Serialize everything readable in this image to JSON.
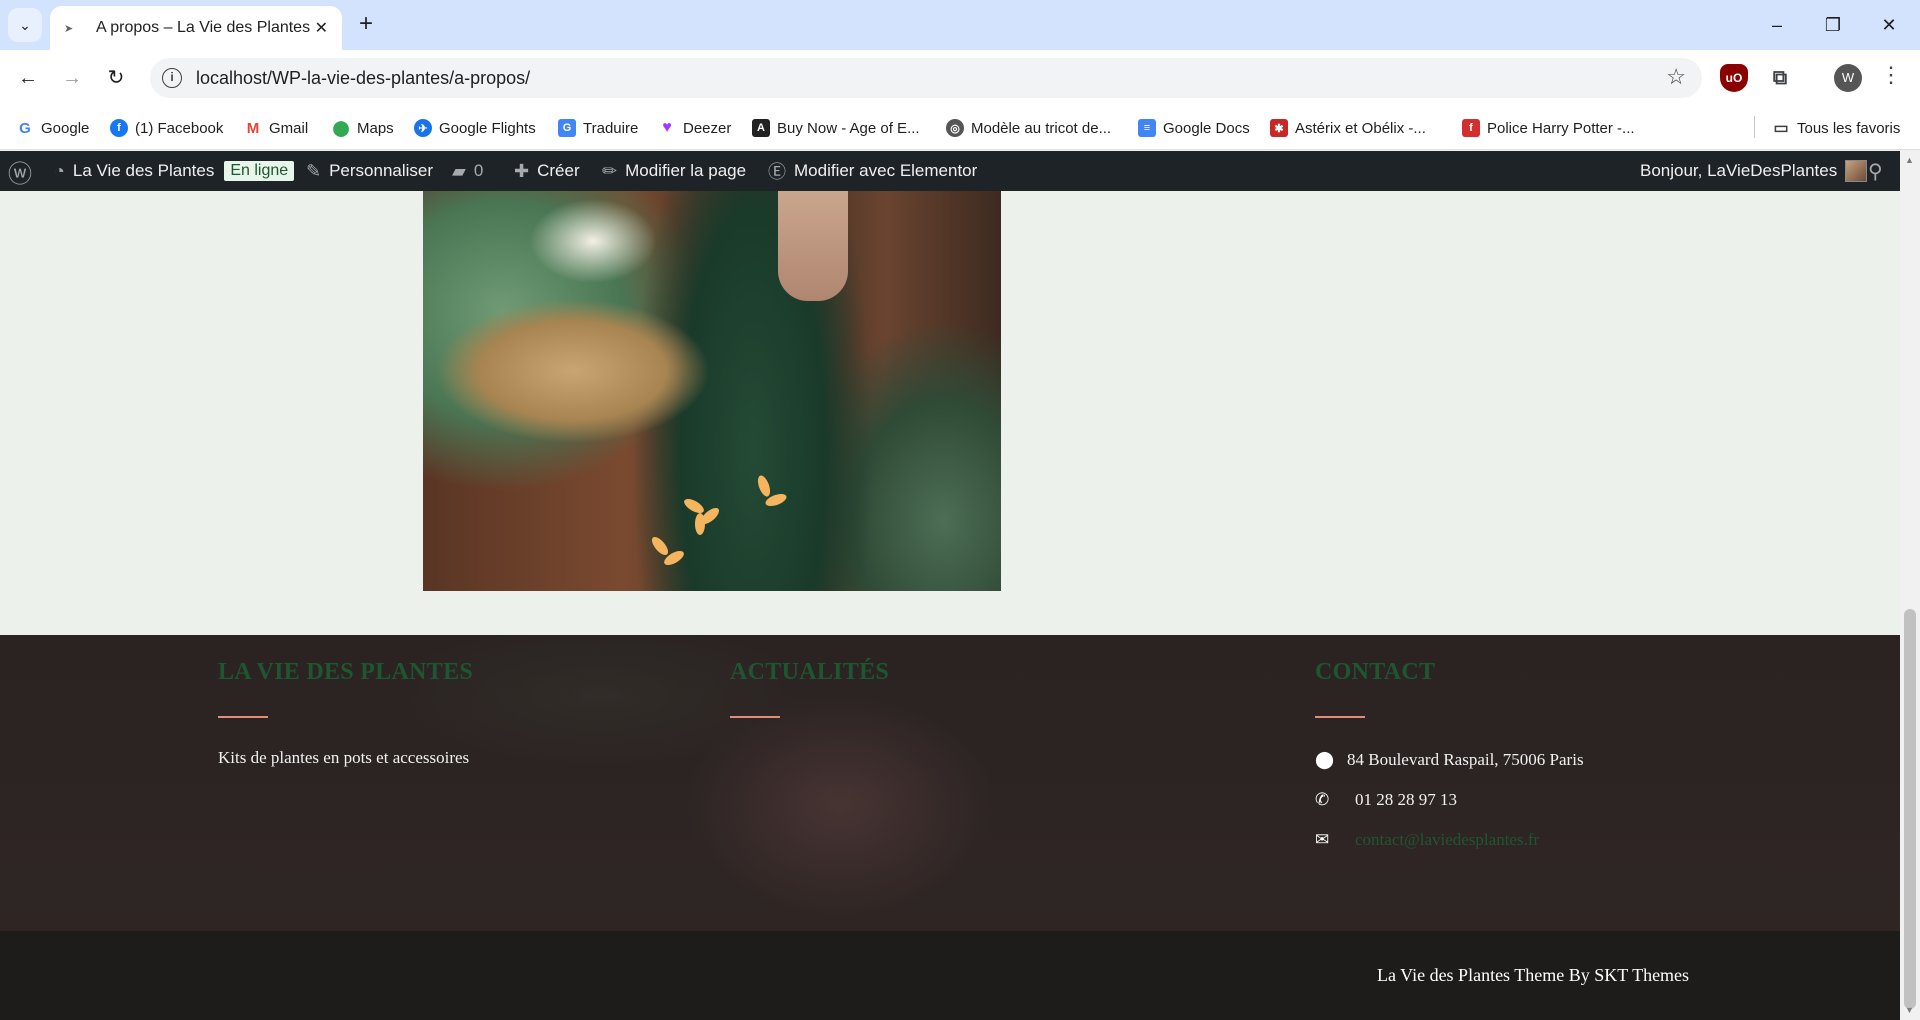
{
  "browser": {
    "tab_title": "A propos – La Vie des Plantes",
    "url": "localhost/WP-la-vie-des-plantes/a-propos/",
    "bookmarks": [
      {
        "label": "Google",
        "icon": "google-icon",
        "color": "#4285f4"
      },
      {
        "label": "(1) Facebook",
        "icon": "facebook-icon",
        "color": "#1877f2"
      },
      {
        "label": "Gmail",
        "icon": "gmail-icon",
        "color": "#ea4335"
      },
      {
        "label": "Maps",
        "icon": "maps-icon",
        "color": "#34a853"
      },
      {
        "label": "Google Flights",
        "icon": "flights-icon",
        "color": "#1a73e8"
      },
      {
        "label": "Traduire",
        "icon": "translate-icon",
        "color": "#4285f4"
      },
      {
        "label": "Deezer",
        "icon": "deezer-icon",
        "color": "#a238ff"
      },
      {
        "label": "Buy Now - Age of E...",
        "icon": "age-of-empires-icon",
        "color": "#222222"
      },
      {
        "label": "Modèle au tricot de...",
        "icon": "knitting-icon",
        "color": "#555555"
      },
      {
        "label": "Google Docs",
        "icon": "docs-icon",
        "color": "#4285f4"
      },
      {
        "label": "Astérix et Obélix -...",
        "icon": "asterix-icon",
        "color": "#c62828"
      },
      {
        "label": "Police Harry Potter -...",
        "icon": "font-icon",
        "color": "#d32f2f"
      }
    ],
    "all_bookmarks": "Tous les favoris"
  },
  "adminbar": {
    "site_name": "La Vie des Plantes",
    "status_badge": "En ligne",
    "customize": "Personnaliser",
    "comments_count": "0",
    "create": "Créer",
    "edit_page": "Modifier la page",
    "edit_elementor": "Modifier avec Elementor",
    "greeting": "Bonjour, LaVieDesPlantes"
  },
  "footer": {
    "col1": {
      "heading": "LA VIE DES PLANTES",
      "text": "Kits de plantes en pots et accessoires"
    },
    "col2": {
      "heading": "ACTUALITÉS"
    },
    "col3": {
      "heading": "CONTACT",
      "address": "84 Boulevard Raspail, 75006 Paris",
      "phone": "01 28 28 97 13",
      "email": "contact@laviedesplantes.fr"
    },
    "copyright": "La Vie des Plantes Theme By SKT Themes"
  },
  "colors": {
    "accent_green": "#1e5631",
    "divider_salmon": "#e08d7e",
    "admin_bar": "#1d2327"
  }
}
